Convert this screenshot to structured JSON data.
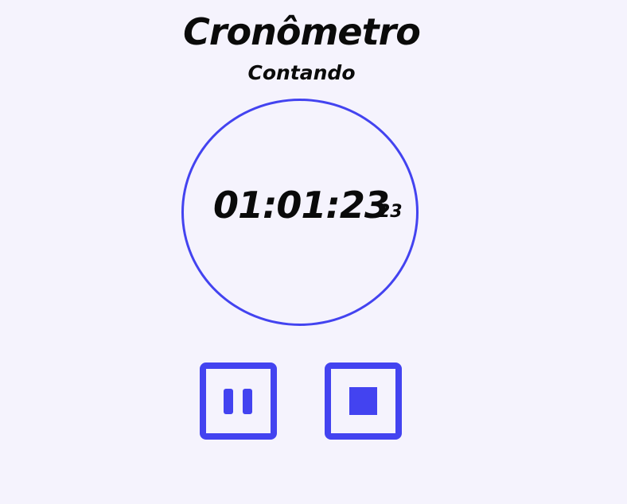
{
  "app": {
    "title": "Cronômetro",
    "status": "Contando"
  },
  "timer": {
    "main": "01:01:23",
    "centiseconds": "23"
  },
  "controls": {
    "pause_icon": "pause-icon",
    "stop_icon": "stop-icon"
  },
  "colors": {
    "accent": "#4343f0",
    "background": "#f5f3fd",
    "text": "#0a0a0a"
  }
}
